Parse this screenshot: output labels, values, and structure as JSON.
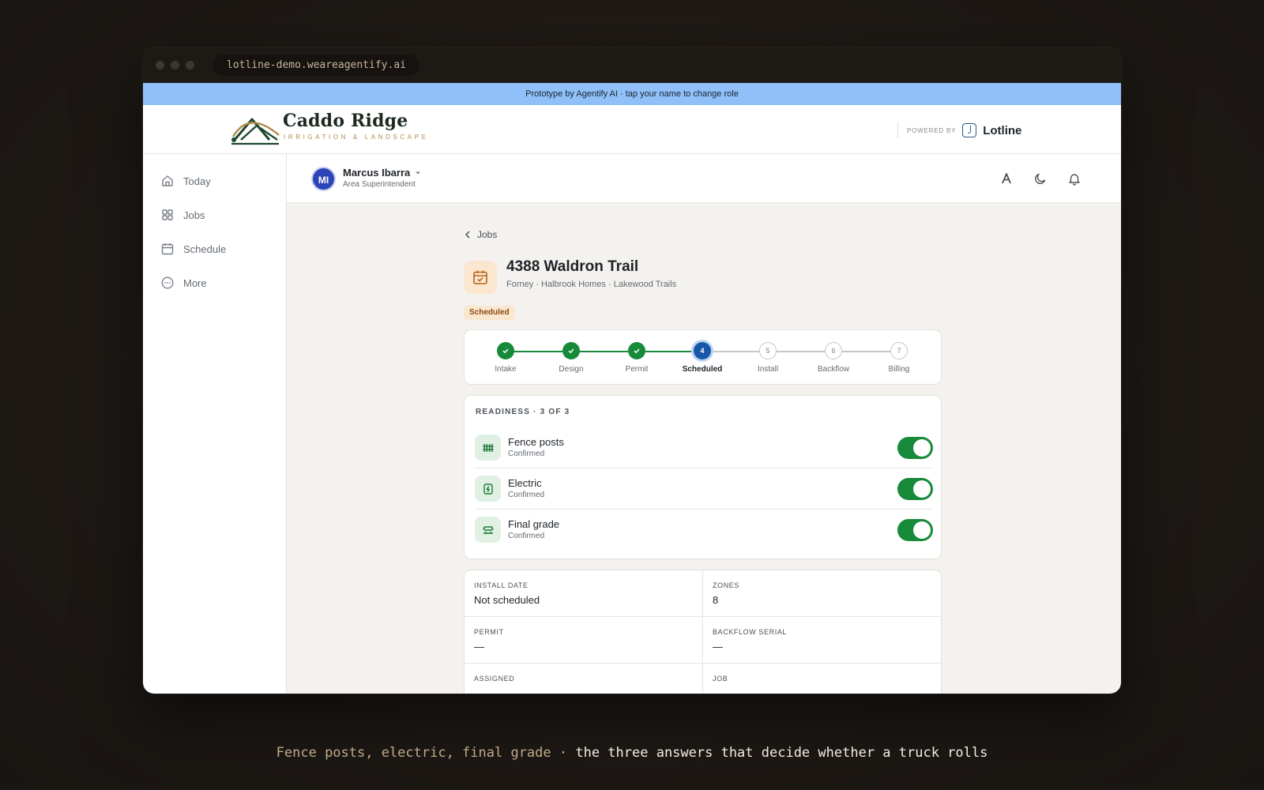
{
  "browser": {
    "url": "lotline-demo.weareagentify.ai"
  },
  "banner": {
    "text": "Prototype by Agentify AI · tap your name to change role"
  },
  "brand": {
    "name": "Caddo Ridge",
    "tagline": "IRRIGATION  &  LANDSCAPE",
    "powered_by": "POWERED BY",
    "platform": "Lotline"
  },
  "sidebar": {
    "items": [
      {
        "label": "Today",
        "icon": "home-icon"
      },
      {
        "label": "Jobs",
        "icon": "grid-icon"
      },
      {
        "label": "Schedule",
        "icon": "calendar-icon"
      },
      {
        "label": "More",
        "icon": "more-icon"
      }
    ]
  },
  "user": {
    "initials": "MI",
    "name": "Marcus Ibarra",
    "role": "Area Superintendent"
  },
  "header_icons": [
    "text-size-icon",
    "moon-icon",
    "bell-icon"
  ],
  "job": {
    "back_label": "Jobs",
    "title": "4388 Waldron Trail",
    "subtitle": "Forney · Halbrook Homes · Lakewood Trails",
    "status": "Scheduled",
    "status_colors": {
      "bg": "#fbe6cf",
      "fg": "#8a4b12"
    }
  },
  "stepper": {
    "steps": [
      {
        "label": "Intake",
        "state": "done",
        "number": "1"
      },
      {
        "label": "Design",
        "state": "done",
        "number": "2"
      },
      {
        "label": "Permit",
        "state": "done",
        "number": "3"
      },
      {
        "label": "Scheduled",
        "state": "current",
        "number": "4"
      },
      {
        "label": "Install",
        "state": "todo",
        "number": "5"
      },
      {
        "label": "Backflow",
        "state": "todo",
        "number": "6"
      },
      {
        "label": "Billing",
        "state": "todo",
        "number": "7"
      }
    ]
  },
  "readiness": {
    "title": "READINESS · 3 OF 3",
    "items": [
      {
        "name": "Fence posts",
        "status": "Confirmed",
        "icon": "fence-icon",
        "enabled": true
      },
      {
        "name": "Electric",
        "status": "Confirmed",
        "icon": "electric-icon",
        "enabled": true
      },
      {
        "name": "Final grade",
        "status": "Confirmed",
        "icon": "grade-icon",
        "enabled": true
      }
    ]
  },
  "details": [
    {
      "label": "INSTALL DATE",
      "value": "Not scheduled"
    },
    {
      "label": "ZONES",
      "value": "8"
    },
    {
      "label": "PERMIT",
      "value": "—"
    },
    {
      "label": "BACKFLOW SERIAL",
      "value": "—"
    },
    {
      "label": "ASSIGNED",
      "value": ""
    },
    {
      "label": "JOB",
      "value": ""
    }
  ],
  "caption": {
    "part1": "Fence posts, electric, final grade · ",
    "part2": "the three answers that decide whether a truck rolls"
  },
  "colors": {
    "accent_green": "#178a3a",
    "current_blue": "#1758a8",
    "banner_blue": "#8fc0f7"
  }
}
